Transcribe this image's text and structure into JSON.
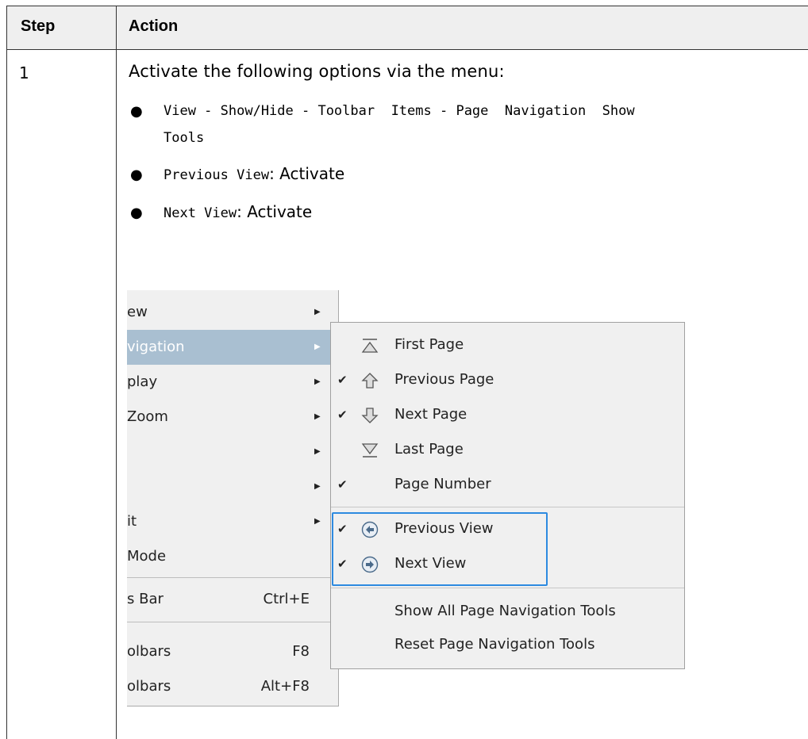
{
  "header": {
    "col1": "Step",
    "col2": "Action"
  },
  "row": {
    "step": "1",
    "intro": "Activate the following options via the menu:",
    "bullets": [
      {
        "line1": "View - Show/Hide - Toolbar  Items - Page  Navigation  Show",
        "line2": "Tools"
      },
      {
        "code": "Previous View",
        "text": ": Activate"
      },
      {
        "code": "Next View",
        "text": ": Activate"
      }
    ]
  },
  "left_menu": {
    "items": [
      {
        "label": "ew",
        "has_arrow": true
      },
      {
        "label": "vigation",
        "has_arrow": true,
        "selected": true
      },
      {
        "label": "play",
        "has_arrow": true
      },
      {
        "label": "Zoom",
        "has_arrow": true
      },
      {
        "label": "",
        "has_arrow": true
      },
      {
        "label": "",
        "has_arrow": true
      },
      {
        "label": "it",
        "has_arrow": true
      },
      {
        "label": "Mode",
        "has_arrow": false
      },
      {
        "label": "s Bar",
        "shortcut": "Ctrl+E"
      },
      {
        "label": "olbars",
        "shortcut": "F8"
      },
      {
        "label": "olbars",
        "shortcut": "Alt+F8"
      }
    ]
  },
  "submenu": {
    "items": [
      {
        "label": "First Page",
        "checked": false,
        "icon": "first-page-icon"
      },
      {
        "label": "Previous Page",
        "checked": true,
        "icon": "previous-page-icon"
      },
      {
        "label": "Next Page",
        "checked": true,
        "icon": "next-page-icon"
      },
      {
        "label": "Last Page",
        "checked": false,
        "icon": "last-page-icon"
      },
      {
        "label": "Page Number",
        "checked": true,
        "icon": ""
      },
      {
        "label": "Previous View",
        "checked": true,
        "icon": "previous-view-icon"
      },
      {
        "label": "Next View",
        "checked": true,
        "icon": "next-view-icon"
      },
      {
        "label": "Show All Page Navigation Tools",
        "checked": false,
        "icon": ""
      },
      {
        "label": "Reset Page Navigation Tools",
        "checked": false,
        "icon": ""
      }
    ],
    "check_glyph": "✔",
    "arrow_glyph": "▶",
    "highlight_color": "#2d8ae0"
  }
}
